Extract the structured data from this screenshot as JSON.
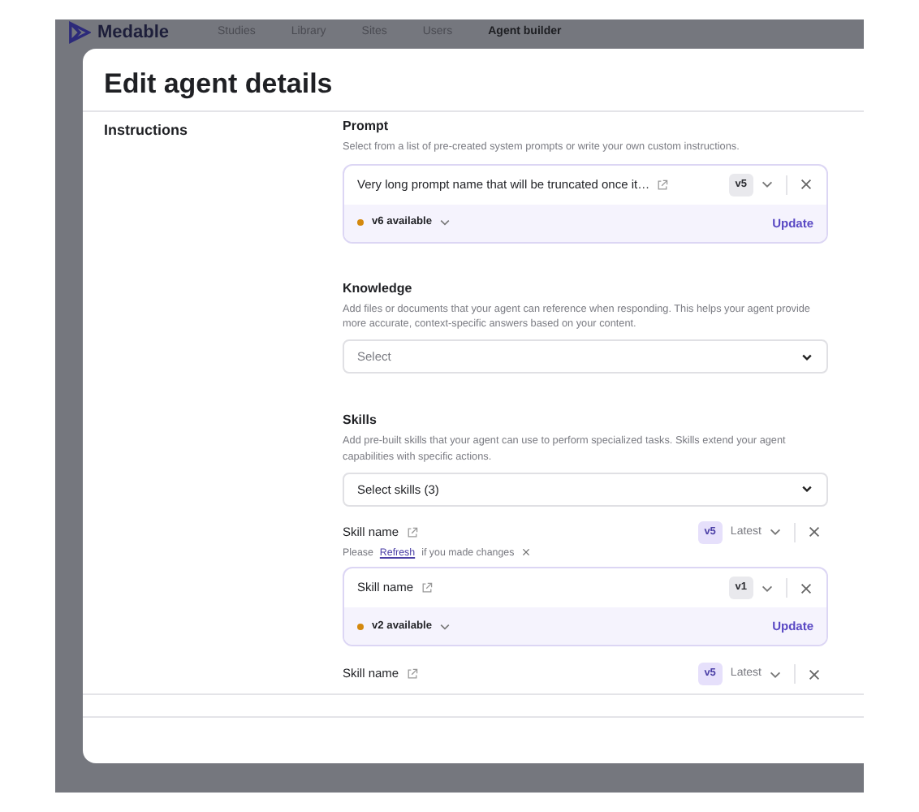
{
  "nav": {
    "brand": "Medable",
    "items": [
      {
        "label": "Studies",
        "selected": false
      },
      {
        "label": "Library",
        "selected": false
      },
      {
        "label": "Sites",
        "selected": false
      },
      {
        "label": "Users",
        "selected": false
      },
      {
        "label": "Agent builder",
        "selected": true
      }
    ]
  },
  "dialog": {
    "title": "Edit agent details",
    "section_label": "Instructions",
    "prompt": {
      "label": "Prompt",
      "help": "Select from a list of pre-created system prompts or write your own custom instructions.",
      "item": {
        "kind": "update",
        "name": "Very long prompt name that will be truncated once it…",
        "version": "v5",
        "latest": false,
        "available": "v6 available",
        "action": "Update"
      }
    },
    "knowledge": {
      "label": "Knowledge",
      "help": "Add files or documents that your agent can reference when responding. This helps your agent provide more accurate, context-specific answers based on your content.",
      "placeholder": "Select"
    },
    "skills": {
      "label": "Skills",
      "help": "Add pre-built skills that your agent can use to perform specialized tasks. Skills extend your agent capabilities with specific actions.",
      "value": "Select skills (3)",
      "items": [
        {
          "kind": "plain",
          "name": "Skill name",
          "version": "v5",
          "latest": true,
          "latest_label": "Latest",
          "notice": {
            "prefix": "Please",
            "link": "Refresh",
            "suffix": "if you made changes"
          }
        },
        {
          "kind": "update",
          "name": "Skill name",
          "version": "v1",
          "latest": false,
          "available": "v2 available",
          "action": "Update"
        },
        {
          "kind": "plain",
          "name": "Skill name",
          "version": "v5",
          "latest": true,
          "latest_label": "Latest"
        }
      ]
    }
  }
}
